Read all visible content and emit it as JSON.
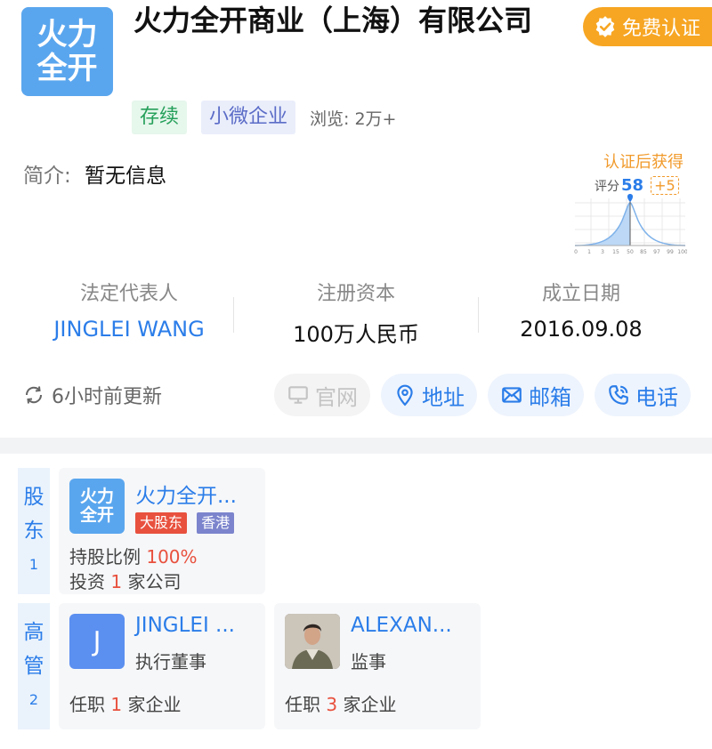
{
  "company": {
    "logo_line1": "火力",
    "logo_line2": "全开",
    "name": "火力全开商业（上海）有限公司",
    "verify_label": "免费认证",
    "tags": [
      "存续",
      "小微企业"
    ],
    "views": "浏览: 2万+",
    "intro_label": "简介:",
    "intro_value": "暂无信息"
  },
  "score": {
    "gain_label": "认证后获得",
    "score_label": "评分",
    "score_value": "58",
    "bonus": "+5",
    "axis_ticks": [
      "0",
      "1",
      "3",
      "15",
      "50",
      "85",
      "97",
      "99",
      "100"
    ]
  },
  "info": {
    "legal_rep_label": "法定代表人",
    "legal_rep_value": "JINGLEI WANG",
    "capital_label": "注册资本",
    "capital_value": "100万人民币",
    "date_label": "成立日期",
    "date_value": "2016.09.08"
  },
  "update_text": "6小时前更新",
  "actions": {
    "website": "官网",
    "address": "地址",
    "email": "邮箱",
    "phone": "电话"
  },
  "shareholders": {
    "tab_line1": "股",
    "tab_line2": "东",
    "count": "1",
    "card": {
      "logo_line1": "火力",
      "logo_line2": "全开",
      "name": "火力全开...",
      "badge_major": "大股东",
      "badge_region": "香港",
      "ratio_label": "持股比例",
      "ratio_value": "100%",
      "invest_prefix": "投资",
      "invest_count": "1",
      "invest_suffix": "家公司"
    }
  },
  "executives": {
    "tab_line1": "高",
    "tab_line2": "管",
    "count": "2",
    "people": [
      {
        "avatar_letter": "J",
        "name": "JINGLEI ...",
        "role": "执行董事",
        "job_prefix": "任职",
        "job_count": "1",
        "job_suffix": "家企业"
      },
      {
        "name": "ALEXAN...",
        "role": "监事",
        "job_prefix": "任职",
        "job_count": "3",
        "job_suffix": "家企业"
      }
    ]
  },
  "colors": {
    "accent": "#2b7de9",
    "logo_blue": "#5aa6ee",
    "verify_orange": "#f7a623",
    "highlight_red": "#e8513e",
    "status_green": "#25a05a"
  }
}
